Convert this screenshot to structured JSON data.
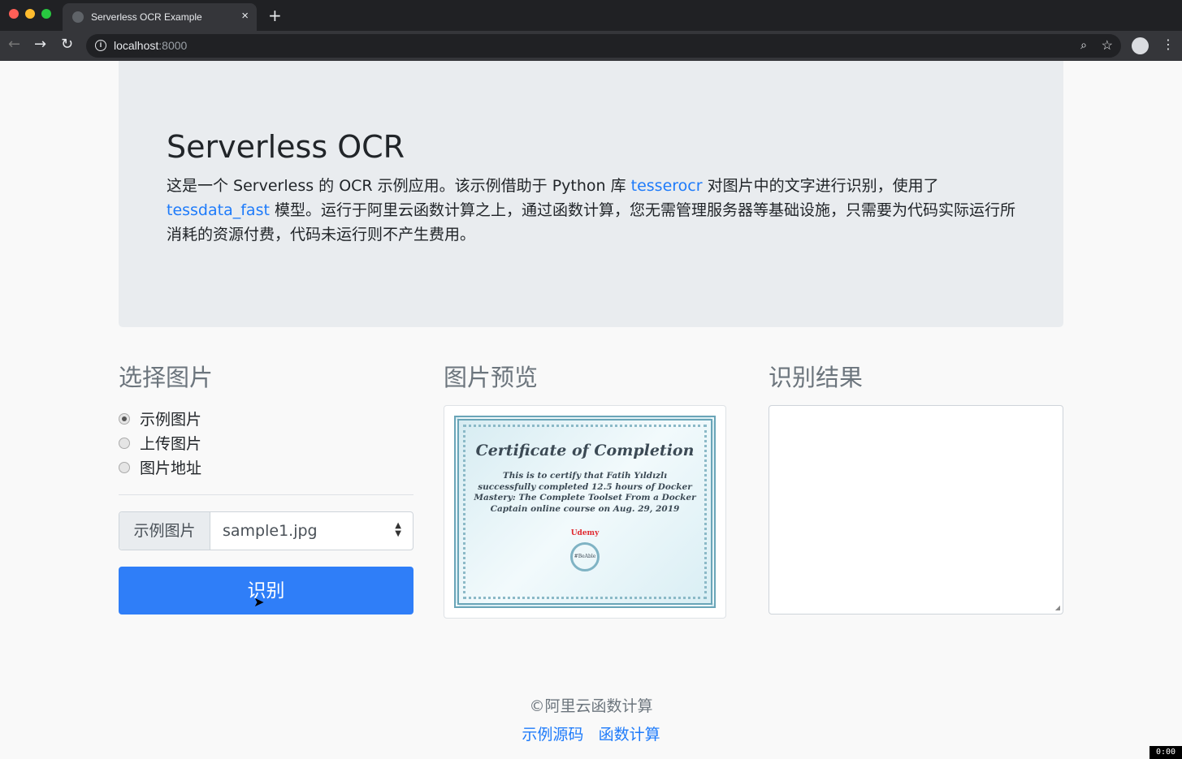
{
  "browser": {
    "tab_title": "Serverless OCR Example",
    "url_host": "localhost",
    "url_port": ":8000",
    "new_tab": "+",
    "close": "×"
  },
  "jumbotron": {
    "title": "Serverless OCR",
    "desc_1": "这是一个 Serverless 的 OCR 示例应用。该示例借助于 Python 库 ",
    "link_tesserocr": "tesserocr",
    "desc_2": " 对图片中的文字进行识别，使用了 ",
    "link_tessdata": "tessdata_fast",
    "desc_3": " 模型。运行于阿里云函数计算之上，通过函数计算，您无需管理服务器等基础设施，只需要为代码实际运行所消耗的资源付费，代码未运行则不产生费用。"
  },
  "select": {
    "heading": "选择图片",
    "options": [
      {
        "label": "示例图片",
        "checked": true
      },
      {
        "label": "上传图片",
        "checked": false
      },
      {
        "label": "图片地址",
        "checked": false
      }
    ],
    "prefix": "示例图片",
    "value": "sample1.jpg",
    "button": "识别"
  },
  "preview": {
    "heading": "图片预览",
    "image": {
      "title": "Certificate of Completion",
      "body": "This is to certify that Fatih Yıldızlı successfully completed 12.5 hours of Docker Mastery: The Complete Toolset From a Docker Captain online course on Aug. 29, 2019",
      "logo": "Udemy",
      "seal": "#BeAble"
    }
  },
  "result": {
    "heading": "识别结果",
    "value": ""
  },
  "footer": {
    "copyright": "©阿里云函数计算",
    "links": [
      "示例源码",
      "函数计算"
    ]
  },
  "overlay": {
    "badge": "0:00"
  }
}
